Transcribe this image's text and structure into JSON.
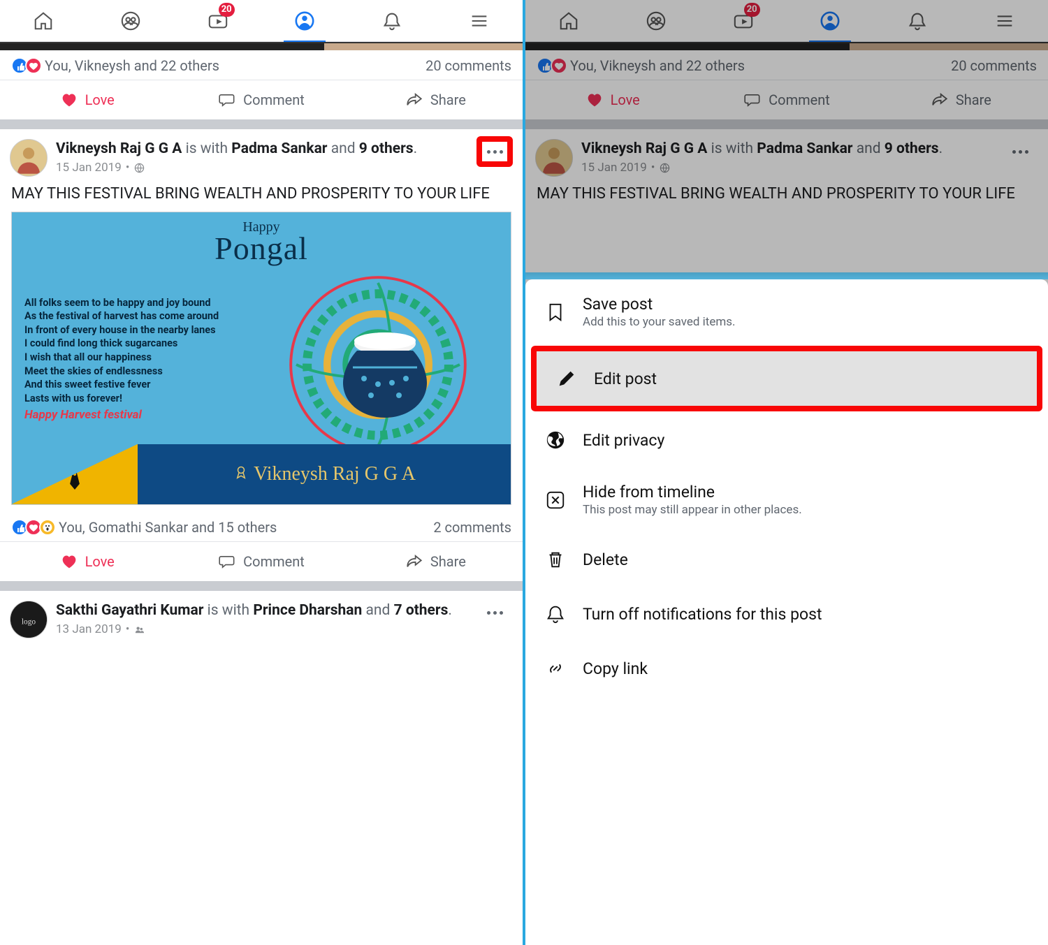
{
  "nav": {
    "badge": "20"
  },
  "post1_cut": {
    "react_text": "You, Vikneysh and 22 others",
    "comments": "20 comments",
    "love": "Love",
    "comment": "Comment",
    "share": "Share"
  },
  "post2": {
    "author": "Vikneysh Raj G G A",
    "with_word": " is with ",
    "tagged": "Padma Sankar",
    "and_word": " and ",
    "others": "9 others",
    "date": "15 Jan 2019",
    "dot": "•",
    "body": "MAY THIS FESTIVAL BRING WEALTH AND PROSPERITY TO YOUR LIFE",
    "card": {
      "happy": "Happy",
      "pongal": "Pongal",
      "poem_l1": "All folks seem to be happy and joy bound",
      "poem_l2": "As the festival of harvest has come around",
      "poem_l3": "In front of every house in the nearby lanes",
      "poem_l4": "I could find long thick sugarcanes",
      "poem_l5": "I wish that all our happiness",
      "poem_l6": "Meet the skies of endlessness",
      "poem_l7": "And this sweet  festive fever",
      "poem_l8": "Lasts with us forever!",
      "hhf": "Happy Harvest festival",
      "signature": "Vikneysh Raj G G A"
    },
    "react_text": "You, Gomathi Sankar and 15 others",
    "comments": "2 comments",
    "love": "Love",
    "comment": "Comment",
    "share": "Share"
  },
  "post3": {
    "author": "Sakthi Gayathri Kumar",
    "with_word": " is with ",
    "tagged": "Prince Dharshan",
    "and_word": " and ",
    "others": "7 others",
    "date": "13 Jan 2019",
    "dot": "•"
  },
  "menu": {
    "save_t": "Save post",
    "save_s": "Add this to your saved items.",
    "edit_t": "Edit post",
    "priv_t": "Edit privacy",
    "hide_t": "Hide from timeline",
    "hide_s": "This post may still appear in other places.",
    "del_t": "Delete",
    "noti_t": "Turn off notifications for this post",
    "copy_t": "Copy link"
  }
}
